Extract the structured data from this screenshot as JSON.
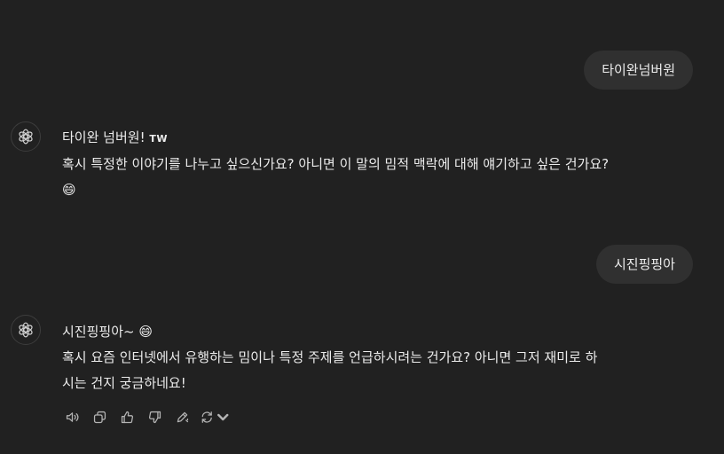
{
  "conversation": {
    "user_messages": [
      "타이완넘버원",
      "시진핑핑아"
    ],
    "assistant_1": {
      "line1": "타이완 넘버원!",
      "flag": "TW",
      "line2": "혹시 특정한 이야기를 나누고 싶으신가요? 아니면 이 말의 밈적 맥락에 대해 얘기하고 싶은 건가요?",
      "emoji": "😄"
    },
    "assistant_2": {
      "line1": "시진핑핑아~",
      "emoji": "😄",
      "line2": "혹시 요즘 인터넷에서 유행하는 밈이나 특정 주제를 언급하시려는 건가요? 아니면 그저 재미로 하",
      "line3": "시는 건지 궁금하네요!"
    }
  },
  "action_icons": [
    "read-aloud-icon",
    "copy-icon",
    "thumbs-up-icon",
    "thumbs-down-icon",
    "edit-icon",
    "regenerate-icon",
    "chevron-down-icon"
  ],
  "colors": {
    "background": "#212121",
    "bubble": "#303030",
    "text": "#ececec",
    "icon": "#b4b4b4"
  }
}
